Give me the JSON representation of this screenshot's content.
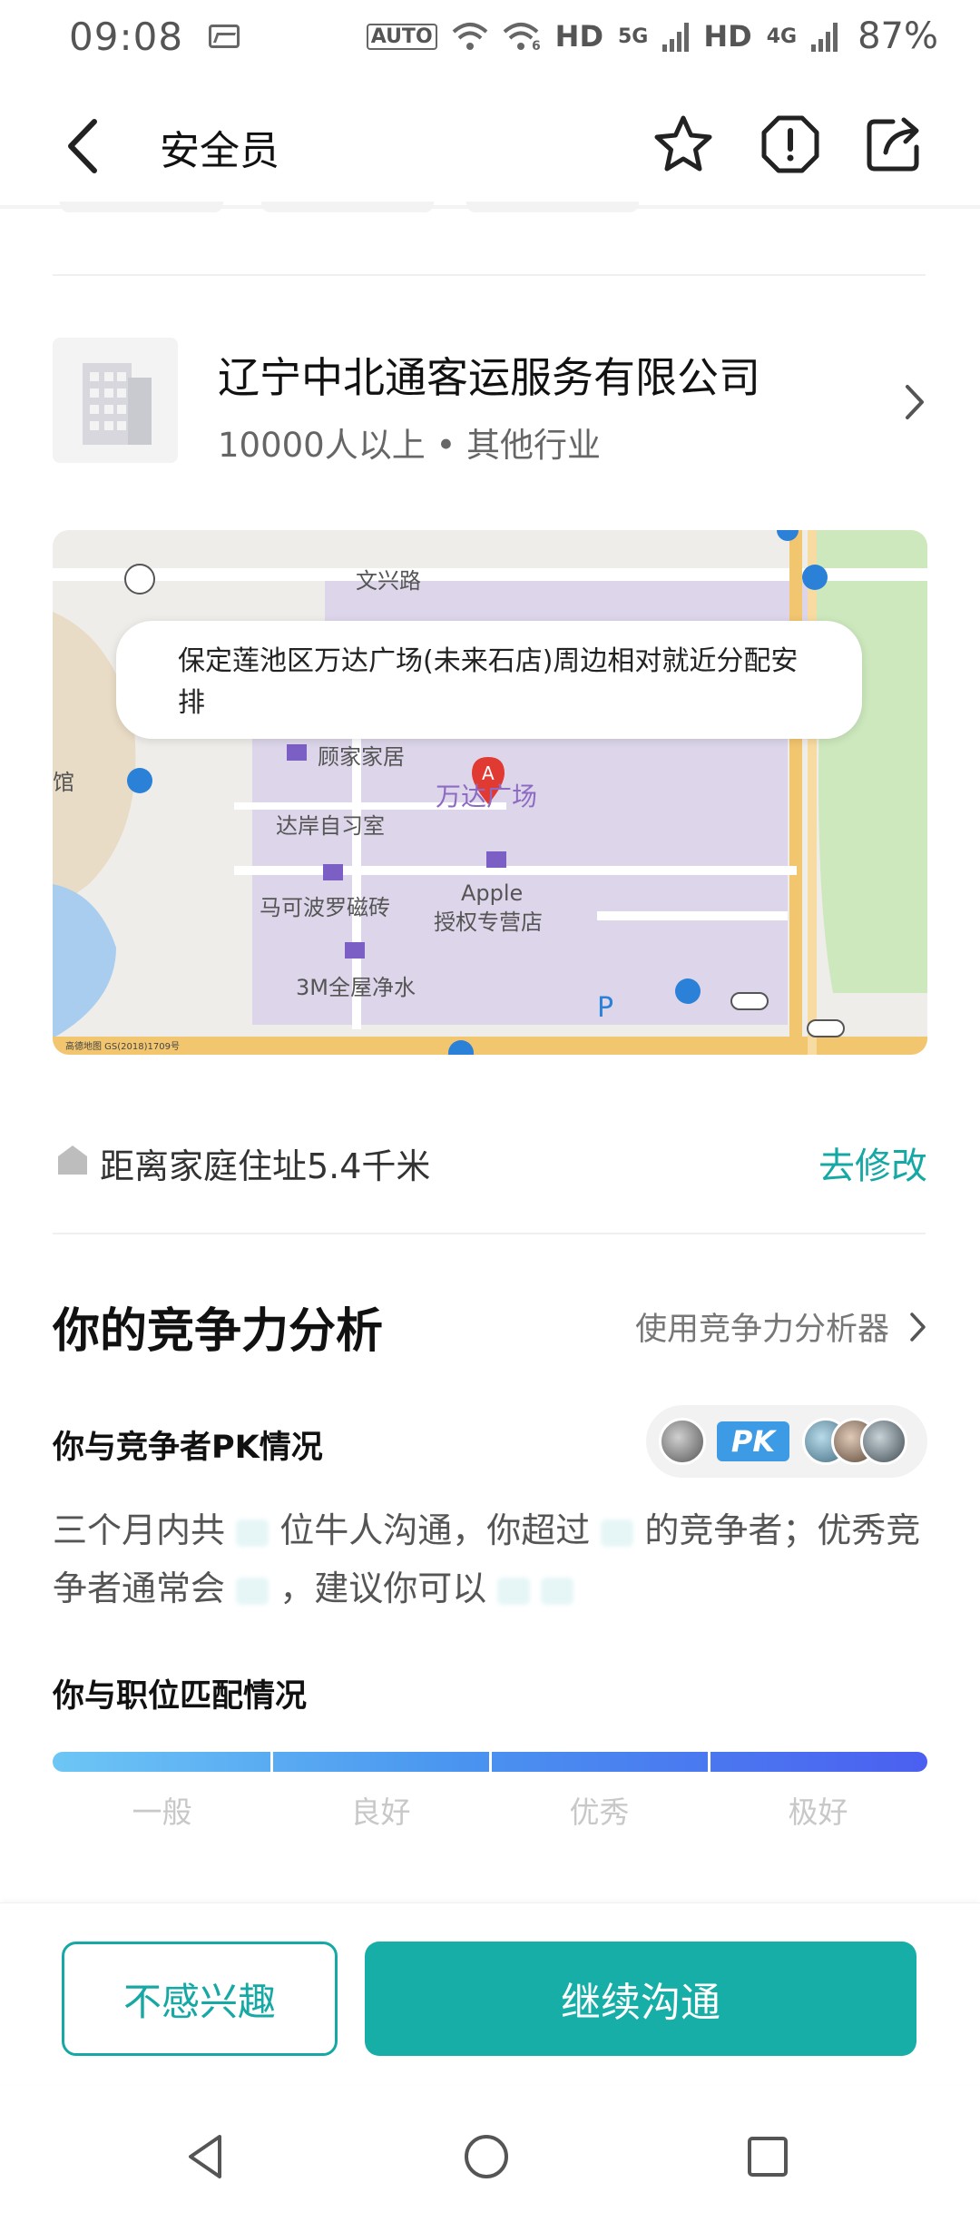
{
  "status_bar": {
    "time": "09:08",
    "indicators": [
      "AUTO",
      "HD",
      "5G",
      "HD",
      "4G"
    ],
    "battery": "87%"
  },
  "header": {
    "title": "安全员"
  },
  "company": {
    "name": "辽宁中北通客运服务有限公司",
    "meta": "10000人以上 • 其他行业"
  },
  "map": {
    "bubble_text": "保定莲池区万达广场(未来石店)周边相对就近分配安排",
    "labels": {
      "road": "文兴路",
      "poi1": "顾家家居",
      "poi2": "万达广场",
      "poi3": "达岸自习室",
      "poi4": "马可波罗磁砖",
      "poi5": "Apple",
      "poi5b": "授权专营店",
      "poi6": "3M全屋净水",
      "left_edge": "馆",
      "copyright": "高德地图  GS(2018)1709号"
    }
  },
  "distance": {
    "text": "距离家庭住址5.4千米",
    "edit_label": "去修改"
  },
  "competitiveness": {
    "title": "你的竞争力分析",
    "analyzer_link": "使用竞争力分析器",
    "pk_title": "你与竞争者PK情况",
    "pk_tag": "PK",
    "pk_text": {
      "p1": "三个月内共",
      "p2": "位牛人沟通，你超过",
      "p3": "的竞争者；优秀竞争者通常会",
      "p4": "，建议你可以"
    },
    "match_title": "你与职位匹配情况",
    "match_levels": [
      "一般",
      "良好",
      "优秀",
      "极好"
    ]
  },
  "actions": {
    "not_interested": "不感兴趣",
    "continue": "继续沟通"
  },
  "colors": {
    "accent": "#16a8a4",
    "bar_start": "#6dc6f5",
    "bar_end": "#4b5ff0"
  }
}
